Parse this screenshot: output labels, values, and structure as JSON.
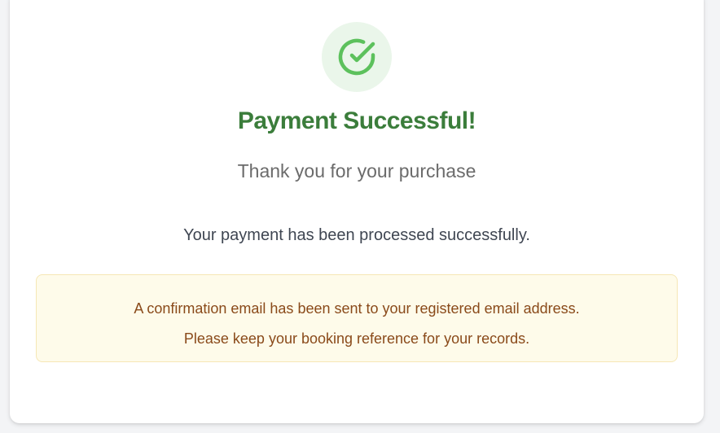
{
  "status": {
    "icon": "check-circle-icon",
    "title": "Payment Successful!",
    "subtitle": "Thank you for your purchase"
  },
  "message": "Your payment has been processed successfully.",
  "notice": {
    "line1": "A confirmation email has been sent to your registered email address.",
    "line2": "Please keep your booking reference for your records."
  },
  "colors": {
    "success_green": "#3b7d3b",
    "icon_green": "#5cc15c",
    "icon_bg": "#eaf6ea",
    "notice_bg": "#fefbea",
    "notice_border": "#f6e7b5",
    "notice_text": "#8a4a1a"
  }
}
